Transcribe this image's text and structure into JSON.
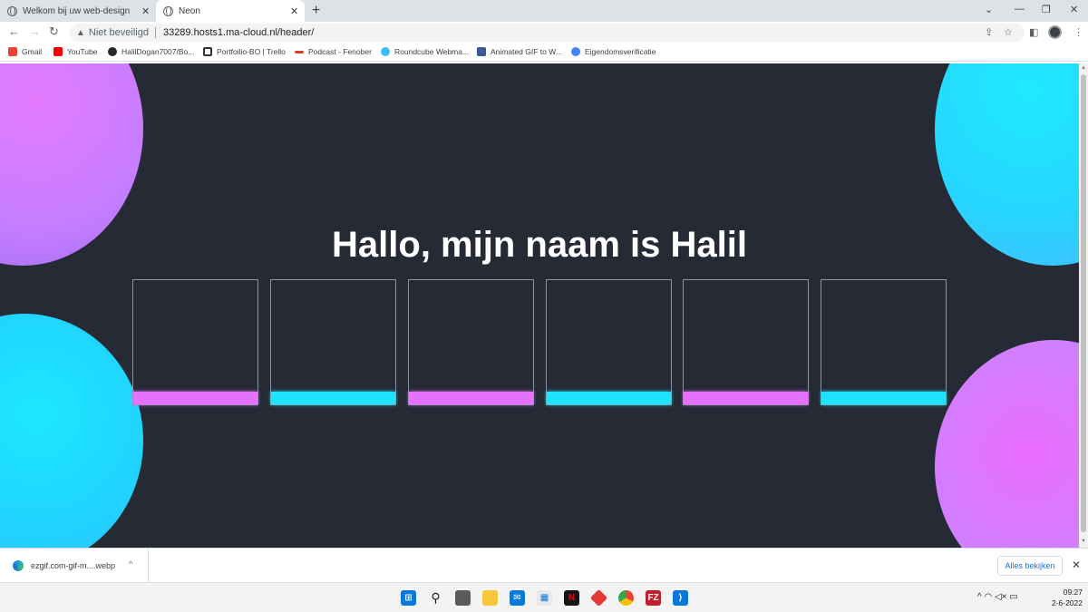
{
  "browser": {
    "tabs": [
      {
        "title": "Welkom bij uw web-design webs",
        "active": false
      },
      {
        "title": "Neon",
        "active": true
      }
    ],
    "new_tab": "+",
    "security_label": "Niet beveiligd",
    "url": "33289.hosts1.ma-cloud.nl/header/",
    "bookmarks": [
      {
        "label": "Gmail",
        "icon": "gmail-icon",
        "color": "#ea4335"
      },
      {
        "label": "YouTube",
        "icon": "youtube-icon",
        "color": "#ff0000"
      },
      {
        "label": "HalilDogan7007/Bo...",
        "icon": "github-icon",
        "color": "#24292e"
      },
      {
        "label": "Portfoilio-BO | Trello",
        "icon": "trello-icon",
        "color": "#0079bf"
      },
      {
        "label": "Podcast - Fenober",
        "icon": "podcast-icon",
        "color": "#e53935"
      },
      {
        "label": "Roundcube Webma...",
        "icon": "roundcube-icon",
        "color": "#37beff"
      },
      {
        "label": "Animated GIF to W...",
        "icon": "ezgif-icon",
        "color": "#3a5a9c"
      },
      {
        "label": "Eigendomsverificatie",
        "icon": "google-search-console-icon",
        "color": "#4285f4"
      }
    ]
  },
  "page": {
    "heading": "Hallo, mijn naam is Halil",
    "background": "#252a34",
    "accent_pink": "#e472ff",
    "accent_cyan": "#1ee3ff",
    "boxes": [
      {
        "bar_color": "pink"
      },
      {
        "bar_color": "cyan"
      },
      {
        "bar_color": "pink"
      },
      {
        "bar_color": "cyan"
      },
      {
        "bar_color": "pink"
      },
      {
        "bar_color": "cyan"
      }
    ]
  },
  "download_bar": {
    "file_name": "ezgif.com-gif-m....webp",
    "show_all": "Alles bekijken"
  },
  "taskbar": {
    "time": "09:27",
    "date": "2-6-2022"
  }
}
